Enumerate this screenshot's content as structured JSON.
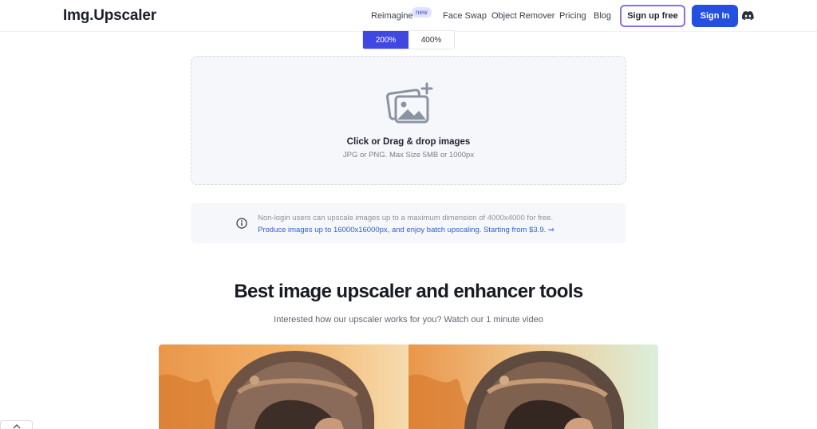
{
  "header": {
    "logo": "Img.Upscaler",
    "nav": [
      {
        "label": "Reimagine"
      },
      {
        "label": "Face Swap"
      },
      {
        "label": "Object Remover"
      },
      {
        "label": "Pricing"
      },
      {
        "label": "Blog"
      }
    ],
    "new_badge": "new",
    "signup_label": "Sign up free",
    "signin_label": "Sign In",
    "discord_icon": "discord-icon"
  },
  "scale": {
    "options": [
      "200%",
      "400%"
    ],
    "selected": "200%"
  },
  "upload": {
    "title": "Click or Drag & drop images",
    "subtitle": "JPG or PNG. Max Size 5MB or 1000px",
    "icon": "add-image-icon"
  },
  "notice": {
    "line1": "Non-login users can upscale images up to a maximum dimension of 4000x4000 for free.",
    "line2": "Produce images up to 16000x16000px, and enjoy batch upscaling. Starting from $3.9. ⇒",
    "icon": "info-icon"
  },
  "section": {
    "title": "Best image upscaler and enhancer tools",
    "subtitle": "Interested how our upscaler works for you? Watch our 1 minute video"
  },
  "colors": {
    "primary": "#2350E0",
    "accent": "#3F48E0",
    "signup_border": "#8B6CF0"
  }
}
